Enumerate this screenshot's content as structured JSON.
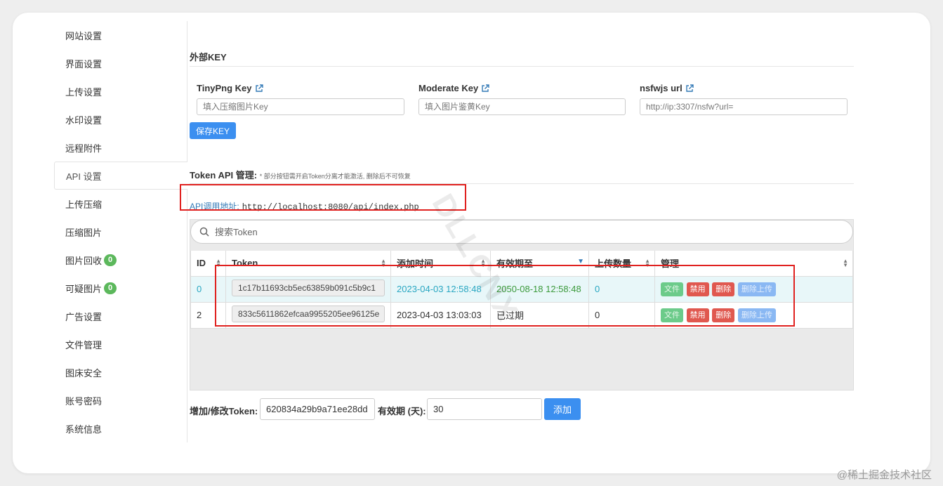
{
  "sidebar": {
    "items": [
      {
        "label": "网站设置"
      },
      {
        "label": "界面设置"
      },
      {
        "label": "上传设置"
      },
      {
        "label": "水印设置"
      },
      {
        "label": "远程附件"
      },
      {
        "label": "API 设置",
        "active": true
      },
      {
        "label": "上传压缩"
      },
      {
        "label": "压缩图片"
      },
      {
        "label": "图片回收",
        "badge": "0"
      },
      {
        "label": "可疑图片",
        "badge": "0"
      },
      {
        "label": "广告设置"
      },
      {
        "label": "文件管理"
      },
      {
        "label": "图床安全"
      },
      {
        "label": "账号密码"
      },
      {
        "label": "系统信息"
      }
    ]
  },
  "external_key": {
    "title": "外部KEY",
    "tinypng": {
      "label": "TinyPng Key",
      "placeholder": "填入压缩图片Key"
    },
    "moderate": {
      "label": "Moderate Key",
      "placeholder": "填入图片鉴黄Key"
    },
    "nsfwjs": {
      "label": "nsfwjs url",
      "placeholder": "http://ip:3307/nsfw?url="
    },
    "save_label": "保存KEY",
    "icon": "external-link-icon"
  },
  "token_api": {
    "title": "Token API 管理:",
    "note": "* 部分按钮需开启Token分离才能激活, 删除后不可恢复",
    "api_url_label": "API调用地址:",
    "api_url": "http://localhost:8080/api/index.php"
  },
  "search": {
    "placeholder": "搜索Token",
    "icon": "search-icon"
  },
  "table": {
    "headers": [
      "ID",
      "Token",
      "添加时间",
      "有效期至",
      "上传数量",
      "管理"
    ],
    "rows": [
      {
        "id": "0",
        "token": "1c17b11693cb5ec63859b091c5b9c1",
        "added": "2023-04-03 12:58:48",
        "expires": "2050-08-18 12:58:48",
        "uploads": "0"
      },
      {
        "id": "2",
        "token": "833c5611862efcaa9955205ee96125e",
        "added": "2023-04-03 13:03:03",
        "expires": "已过期",
        "uploads": "0"
      }
    ],
    "actions": {
      "file": "文件",
      "ban": "禁用",
      "delete": "删除",
      "delete_uploads": "删除上传"
    }
  },
  "bottom_form": {
    "token_label": "增加/修改Token:",
    "token_value": "620834a29b9a71ee28dd",
    "days_label": "有效期 (天):",
    "days_value": "30",
    "add_label": "添加"
  },
  "watermark": "DLLCNX",
  "footer": "@稀土掘金技术社区",
  "colors": {
    "primary": "#3b8ff0",
    "danger": "#e0584f",
    "success": "#5cb85c",
    "highlight_box": "#e0211f",
    "link": "#337ab7"
  }
}
